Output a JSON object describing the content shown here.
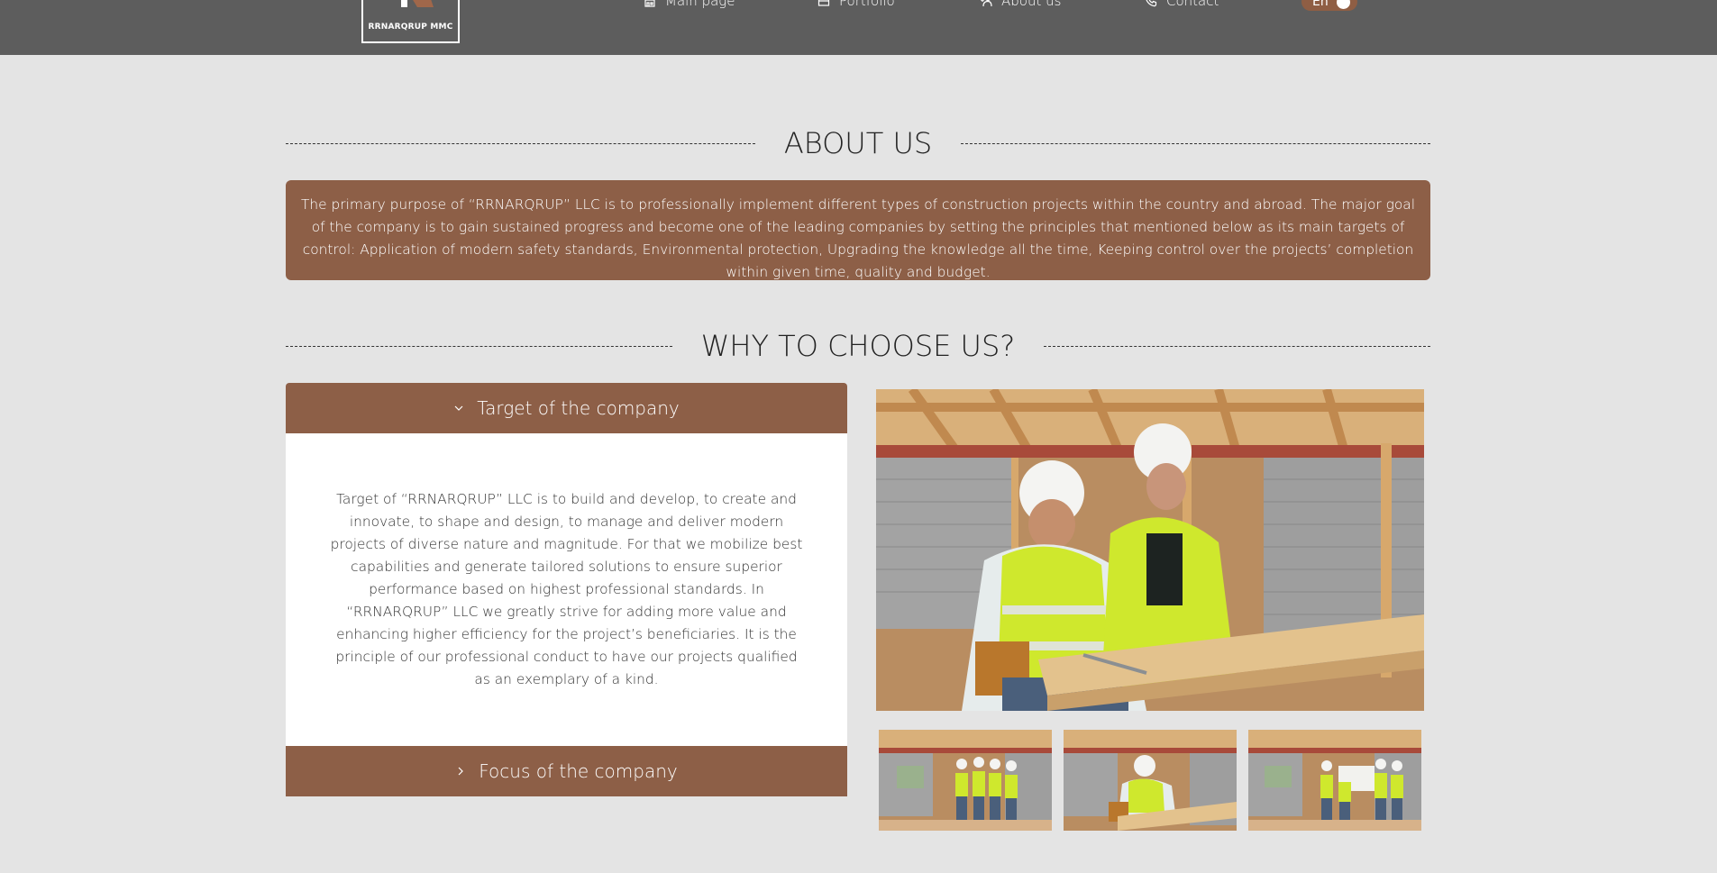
{
  "header": {
    "logo_text": "RRNARQRUP MMC",
    "nav": [
      {
        "label": "Main page",
        "icon": "home-icon"
      },
      {
        "label": "Portfolio",
        "icon": "portfolio-icon"
      },
      {
        "label": "About us",
        "icon": "people-icon"
      },
      {
        "label": "Contact",
        "icon": "phone-icon"
      }
    ],
    "language": "En"
  },
  "about": {
    "title": "ABOUT US",
    "text": "The primary purpose of “RRNARQRUP” LLC is to professionally implement different types of construction projects within the country and abroad. The major goal of the company is to gain sustained progress and become one of the leading companies by setting the principles that mentioned below as its main targets of control: Application of modern safety standards, Environmental protection, Upgrading the knowledge all the time, Keeping control over the projects’ completion within given time, quality and budget."
  },
  "why": {
    "title": "WHY TO CHOOSE US?",
    "accordion": [
      {
        "label": "Target of the company",
        "expanded": true,
        "text": "Target of “RRNARQRUP” LLC is to build and develop, to create and innovate, to shape and design, to manage and deliver modern projects of diverse nature and magnitude. For that we mobilize best capabilities and generate tailored solutions to ensure superior performance based on highest professional standards. In “RRNARQRUP” LLC  we greatly strive for adding more value and enhancing higher efficiency for the project’s beneficiaries. It is the principle of our professional conduct to have our projects qualified as an exemplary of a kind."
      },
      {
        "label": "Focus of the company",
        "expanded": false
      }
    ]
  },
  "colors": {
    "header_bg": "#5d5d5d",
    "accent_brown": "#8d5f47",
    "page_bg": "#e4e4e4"
  }
}
